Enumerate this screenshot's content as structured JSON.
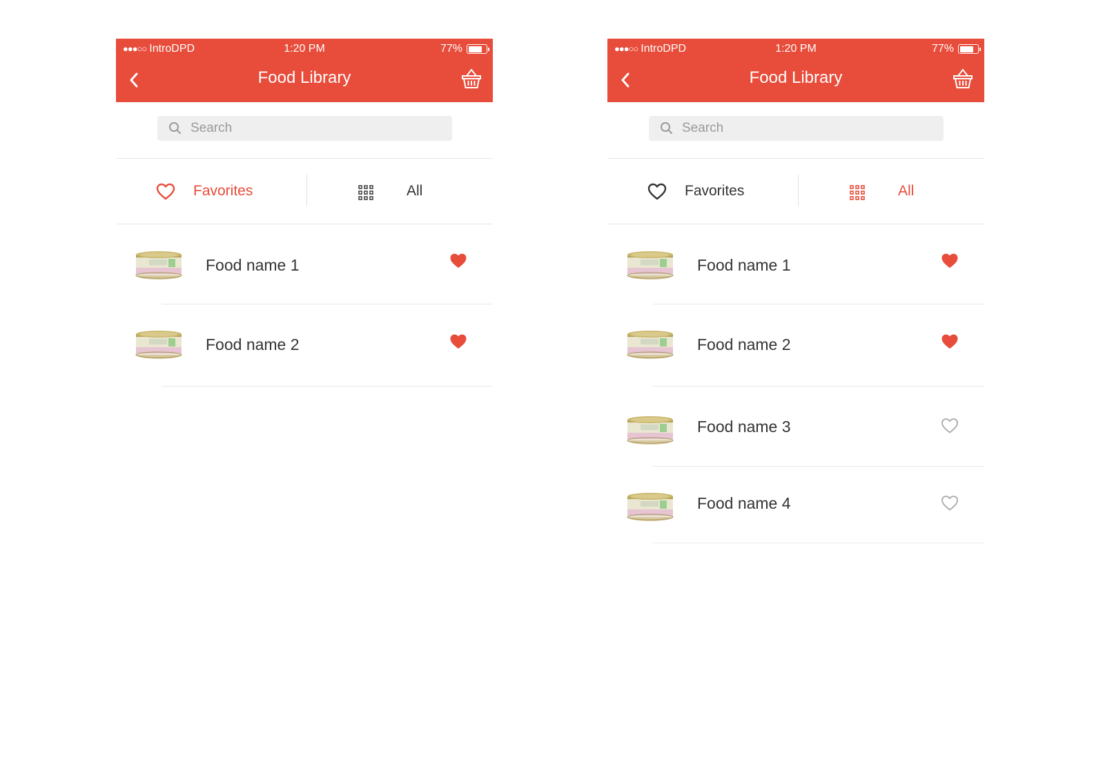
{
  "status_bar": {
    "signal": "●●●○○",
    "carrier": "IntroDPD",
    "time": "1:20 PM",
    "battery": "77%",
    "battery_level": 0.77
  },
  "header": {
    "title": "Food Library"
  },
  "search": {
    "placeholder": "Search"
  },
  "tabs": {
    "favorites": "Favorites",
    "all": "All"
  },
  "colors": {
    "accent": "#e84c3a",
    "text": "#333333",
    "muted": "#9a9a9a"
  },
  "icons": {
    "back": "chevron-left-icon",
    "basket": "basket-icon",
    "search": "search-icon",
    "favorites": "heart-outline-icon",
    "all": "grid-icon",
    "favorite_on": "heart-filled-icon",
    "favorite_off": "heart-outline-icon"
  },
  "screens": [
    {
      "active_tab": "favorites",
      "items": [
        {
          "name": "Food name 1",
          "favorite": true
        },
        {
          "name": "Food name 2",
          "favorite": true
        }
      ]
    },
    {
      "active_tab": "all",
      "items": [
        {
          "name": "Food name 1",
          "favorite": true
        },
        {
          "name": "Food name 2",
          "favorite": true
        },
        {
          "name": "Food name 3",
          "favorite": false
        },
        {
          "name": "Food name 4",
          "favorite": false
        }
      ]
    }
  ]
}
